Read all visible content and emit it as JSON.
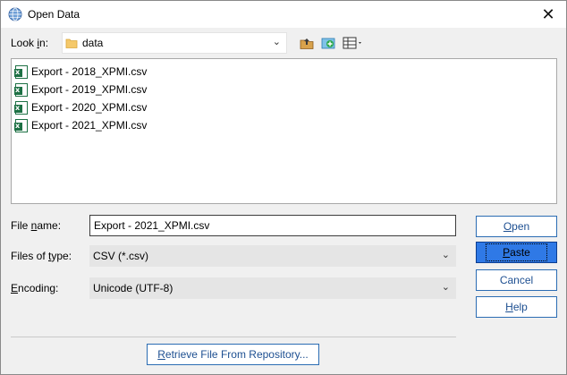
{
  "window": {
    "title": "Open Data",
    "close_glyph": "✕"
  },
  "look_in": {
    "label_pre": "Look ",
    "label_u": "i",
    "label_post": "n:",
    "value": "data",
    "arrow": "⌄"
  },
  "toolbar": {
    "icons": [
      "up-folder-icon",
      "new-folder-icon",
      "view-menu-icon"
    ]
  },
  "files": [
    {
      "name": "Export - 2018_XPMI.csv"
    },
    {
      "name": "Export - 2019_XPMI.csv"
    },
    {
      "name": "Export - 2020_XPMI.csv"
    },
    {
      "name": "Export - 2021_XPMI.csv"
    }
  ],
  "file_name": {
    "label_pre": "File ",
    "label_u": "n",
    "label_post": "ame:",
    "value": "Export - 2021_XPMI.csv"
  },
  "files_of_type": {
    "label_pre": "Files of ",
    "label_u": "t",
    "label_post": "ype:",
    "value": "CSV (*.csv)",
    "arrow": "⌄"
  },
  "encoding": {
    "label_u": "E",
    "label_post": "ncoding:",
    "value": "Unicode (UTF-8)",
    "arrow": "⌄"
  },
  "buttons": {
    "open": {
      "u": "O",
      "rest": "pen"
    },
    "paste": {
      "u": "P",
      "rest": "aste"
    },
    "cancel": {
      "label": "Cancel"
    },
    "help": {
      "u": "H",
      "rest": "elp"
    },
    "retrieve": {
      "u": "R",
      "rest": "etrieve File From Repository..."
    }
  },
  "colors": {
    "accent": "#2f79e6",
    "button_text": "#1d4f91",
    "excel_green": "#1e7145"
  }
}
